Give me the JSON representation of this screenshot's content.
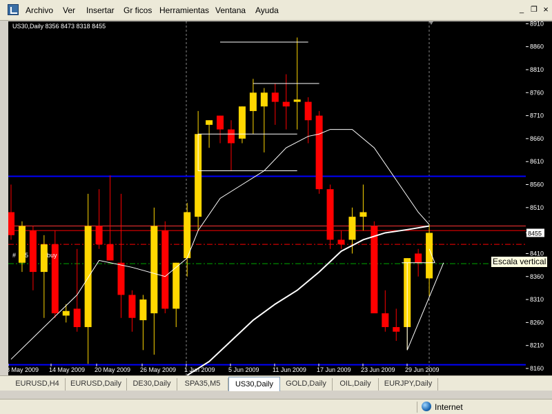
{
  "menu": {
    "items": [
      "Archivo",
      "Ver",
      "Insertar",
      "Gr ficos",
      "Herramientas",
      "Ventana",
      "Ayuda"
    ]
  },
  "chart": {
    "header": "US30,Daily  8356 8473 8318 8455",
    "order_label": "#",
    "order_partial": "5",
    "order_label_tail": "buy",
    "current_price_label": "8455",
    "tooltip": "Escala vertical"
  },
  "chart_data": {
    "type": "candlestick",
    "symbol": "US30",
    "timeframe": "Daily",
    "ylim": [
      8145,
      8915
    ],
    "y_ticks": [
      8910,
      8860,
      8810,
      8760,
      8710,
      8660,
      8610,
      8560,
      8510,
      8455,
      8410,
      8360,
      8310,
      8260,
      8210,
      8160
    ],
    "x_ticks": [
      "8 May 2009",
      "14 May 2009",
      "20 May 2009",
      "26 May 2009",
      "1 Jun 2009",
      "5 Jun 2009",
      "11 Jun 2009",
      "17 Jun 2009",
      "23 Jun 2009",
      "29 Jun 2009"
    ],
    "candles": [
      {
        "o": 8500,
        "h": 8560,
        "l": 8440,
        "c": 8450
      },
      {
        "o": 8390,
        "h": 8480,
        "l": 8370,
        "c": 8470
      },
      {
        "o": 8460,
        "h": 8470,
        "l": 8330,
        "c": 8370
      },
      {
        "o": 8370,
        "h": 8450,
        "l": 8270,
        "c": 8430
      },
      {
        "o": 8430,
        "h": 8460,
        "l": 8270,
        "c": 8280
      },
      {
        "o": 8275,
        "h": 8300,
        "l": 8260,
        "c": 8285
      },
      {
        "o": 8290,
        "h": 8420,
        "l": 8240,
        "c": 8250
      },
      {
        "o": 8250,
        "h": 8540,
        "l": 8170,
        "c": 8470
      },
      {
        "o": 8470,
        "h": 8550,
        "l": 8420,
        "c": 8430
      },
      {
        "o": 8430,
        "h": 8580,
        "l": 8400,
        "c": 8395
      },
      {
        "o": 8390,
        "h": 8540,
        "l": 8270,
        "c": 8320
      },
      {
        "o": 8320,
        "h": 8330,
        "l": 8240,
        "c": 8270
      },
      {
        "o": 8265,
        "h": 8320,
        "l": 8200,
        "c": 8310
      },
      {
        "o": 8280,
        "h": 8510,
        "l": 8190,
        "c": 8470
      },
      {
        "o": 8460,
        "h": 8480,
        "l": 8280,
        "c": 8290
      },
      {
        "o": 8290,
        "h": 8360,
        "l": 8250,
        "c": 8390
      },
      {
        "o": 8400,
        "h": 8520,
        "l": 8360,
        "c": 8500
      },
      {
        "o": 8490,
        "h": 8720,
        "l": 8460,
        "c": 8670
      },
      {
        "o": 8690,
        "h": 8700,
        "l": 8640,
        "c": 8700
      },
      {
        "o": 8710,
        "h": 8700,
        "l": 8650,
        "c": 8680
      },
      {
        "o": 8680,
        "h": 8700,
        "l": 8590,
        "c": 8650
      },
      {
        "o": 8660,
        "h": 8720,
        "l": 8650,
        "c": 8730
      },
      {
        "o": 8720,
        "h": 8790,
        "l": 8670,
        "c": 8760
      },
      {
        "o": 8730,
        "h": 8770,
        "l": 8630,
        "c": 8760
      },
      {
        "o": 8760,
        "h": 8780,
        "l": 8690,
        "c": 8740
      },
      {
        "o": 8740,
        "h": 8800,
        "l": 8680,
        "c": 8730
      },
      {
        "o": 8740,
        "h": 8880,
        "l": 8680,
        "c": 8745
      },
      {
        "o": 8740,
        "h": 8750,
        "l": 8650,
        "c": 8700
      },
      {
        "o": 8710,
        "h": 8720,
        "l": 8540,
        "c": 8550
      },
      {
        "o": 8550,
        "h": 8560,
        "l": 8420,
        "c": 8440
      },
      {
        "o": 8440,
        "h": 8460,
        "l": 8420,
        "c": 8430
      },
      {
        "o": 8440,
        "h": 8510,
        "l": 8410,
        "c": 8490
      },
      {
        "o": 8490,
        "h": 8560,
        "l": 8460,
        "c": 8500
      },
      {
        "o": 8470,
        "h": 8480,
        "l": 8280,
        "c": 8280
      },
      {
        "o": 8280,
        "h": 8330,
        "l": 8240,
        "c": 8250
      },
      {
        "o": 8250,
        "h": 8290,
        "l": 8220,
        "c": 8240
      },
      {
        "o": 8250,
        "h": 8400,
        "l": 8200,
        "c": 8400
      },
      {
        "o": 8410,
        "h": 8420,
        "l": 8360,
        "c": 8390
      },
      {
        "o": 8356,
        "h": 8473,
        "l": 8318,
        "c": 8455
      }
    ],
    "moving_averages": [
      {
        "name": "MA thin",
        "color": "#ffffff",
        "points": [
          [
            0,
            8180
          ],
          [
            3,
            8250
          ],
          [
            6,
            8320
          ],
          [
            8,
            8395
          ],
          [
            11,
            8380
          ],
          [
            14,
            8360
          ],
          [
            16,
            8400
          ],
          [
            17,
            8460
          ],
          [
            19,
            8530
          ],
          [
            21,
            8560
          ],
          [
            23,
            8590
          ],
          [
            25,
            8640
          ],
          [
            27,
            8665
          ],
          [
            28,
            8670
          ],
          [
            29,
            8680
          ],
          [
            31,
            8680
          ],
          [
            33,
            8640
          ],
          [
            35,
            8570
          ],
          [
            37,
            8500
          ],
          [
            38,
            8473
          ]
        ]
      },
      {
        "name": "MA thick",
        "color": "#ffffff",
        "points": [
          [
            16,
            8145
          ],
          [
            18,
            8175
          ],
          [
            20,
            8220
          ],
          [
            22,
            8265
          ],
          [
            24,
            8300
          ],
          [
            26,
            8330
          ],
          [
            28,
            8370
          ],
          [
            30,
            8415
          ],
          [
            32,
            8440
          ],
          [
            34,
            8455
          ],
          [
            36,
            8462
          ],
          [
            38,
            8470
          ]
        ]
      }
    ],
    "horizontal_lines": [
      {
        "price": 8578,
        "color": "#0000ff"
      },
      {
        "price": 8168,
        "color": "#0000ff"
      },
      {
        "price": 8460,
        "color": "#ff0000"
      },
      {
        "price": 8470,
        "color": "#ff3333"
      },
      {
        "price": 8430,
        "color": "#ff0000",
        "style": "dashdot"
      },
      {
        "price": 8388,
        "color": "#00aa00",
        "style": "dashdot"
      }
    ],
    "colors": {
      "bull": "#ffd700",
      "bear": "#ff0000",
      "background": "#000000",
      "axis_text": "#ffffff",
      "price_label_bg": "#ffffff",
      "price_label_text": "#000000"
    }
  },
  "symbol_tabs": {
    "items": [
      "EURUSD,H4",
      "EURUSD,Daily",
      "DE30,Daily",
      "SPA35,M5",
      "US30,Daily",
      "GOLD,Daily",
      "OIL,Daily",
      "EURJPY,Daily"
    ],
    "active": "US30,Daily"
  },
  "statusbar": {
    "zone": "Internet"
  }
}
